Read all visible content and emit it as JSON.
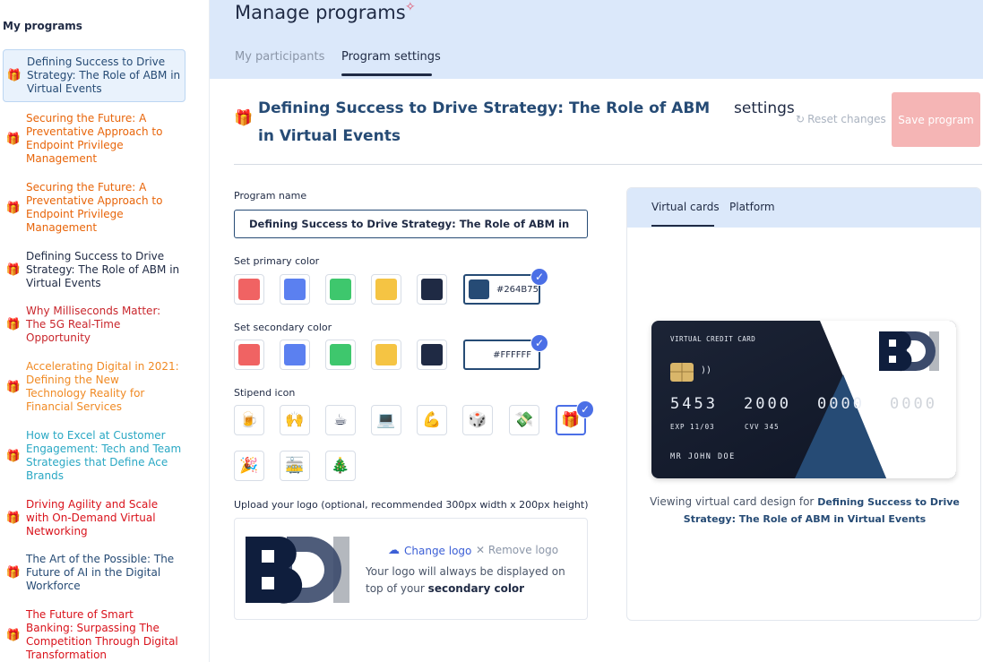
{
  "sidebar": {
    "title": "My programs",
    "items": [
      {
        "label": "Defining Success to Drive Strategy: The Role of ABM in Virtual Events",
        "color": "#264b75",
        "active": true
      },
      {
        "label": "Securing the Future: A Preventative Approach to Endpoint Privilege Management",
        "color": "#e8650a"
      },
      {
        "label": "Securing the Future: A Preventative Approach to Endpoint Privilege Management",
        "color": "#e8650a"
      },
      {
        "label": "Defining Success to Drive Strategy: The Role of ABM in Virtual Events",
        "color": "#1f2a44"
      },
      {
        "label": "Why Milliseconds Matter: The 5G Real-Time Opportunity",
        "color": "#c9262c"
      },
      {
        "label": "Accelerating Digital in 2021: Defining the New Technology Reality for Financial Services",
        "color": "#f08a24"
      },
      {
        "label": "How to Excel at Customer Engagement: Tech and Team Strategies that Define Ace Brands",
        "color": "#2aa8c4"
      },
      {
        "label": "Driving Agility and Scale with On-Demand Virtual Networking",
        "color": "#d9121b"
      },
      {
        "label": "The Art of the Possible: The Future of AI in the Digital Workforce",
        "color": "#264b75"
      },
      {
        "label": "The Future of Smart Banking: Surpassing The Competition Through Digital Transformation",
        "color": "#d9121b"
      }
    ]
  },
  "header": {
    "title": "Manage programs",
    "tabs": [
      {
        "label": "My participants"
      },
      {
        "label": "Program settings"
      }
    ]
  },
  "settings": {
    "program_title": "Defining Success to Drive Strategy: The Role of ABM in Virtual Events",
    "suffix": "settings",
    "reset_label": "Reset changes",
    "save_label": "Save program"
  },
  "form": {
    "program_name_label": "Program name",
    "program_name_value": "Defining Success to Drive Strategy: The Role of ABM in Virtual Events",
    "primary_label": "Set primary color",
    "secondary_label": "Set secondary color",
    "swatches": [
      "#f06363",
      "#5b80f0",
      "#3ec76d",
      "#f5c443",
      "#1f2a44"
    ],
    "primary_value": "#264B75",
    "secondary_value": "#FFFFFF",
    "stipend_label": "Stipend icon",
    "stipend_icons": [
      "🍺",
      "🙌",
      "☕",
      "💻",
      "💪",
      "🎲",
      "💸",
      "🎁",
      "🎉",
      "🚋",
      "🎄"
    ],
    "upload_label": "Upload your logo (optional, recommended 300px width x 200px height)",
    "change_logo": "Change logo",
    "remove_logo": "Remove logo",
    "logo_note_prefix": "Your logo will always be displayed on top of your",
    "logo_note_bold": "secondary color"
  },
  "preview": {
    "tabs": [
      {
        "label": "Virtual cards"
      },
      {
        "label": "Platform"
      }
    ],
    "card": {
      "caption": "VIRTUAL CREDIT CARD",
      "number_groups": [
        "5453",
        "2000",
        "0000",
        "0000"
      ],
      "expiry": "EXP 11/03",
      "cvv": "CVV 345",
      "holder": "MR JOHN DOE"
    },
    "caption_prefix": "Viewing virtual card design for",
    "caption_bold": "Defining Success to Drive Strategy: The Role of ABM in Virtual Events"
  },
  "colors": {
    "primary": "#264b75",
    "accent": "#4b6fe6",
    "save_disabled": "#f5b5b5",
    "header_bg": "#dbe8fa"
  },
  "icons": {
    "gift": "🎁"
  }
}
